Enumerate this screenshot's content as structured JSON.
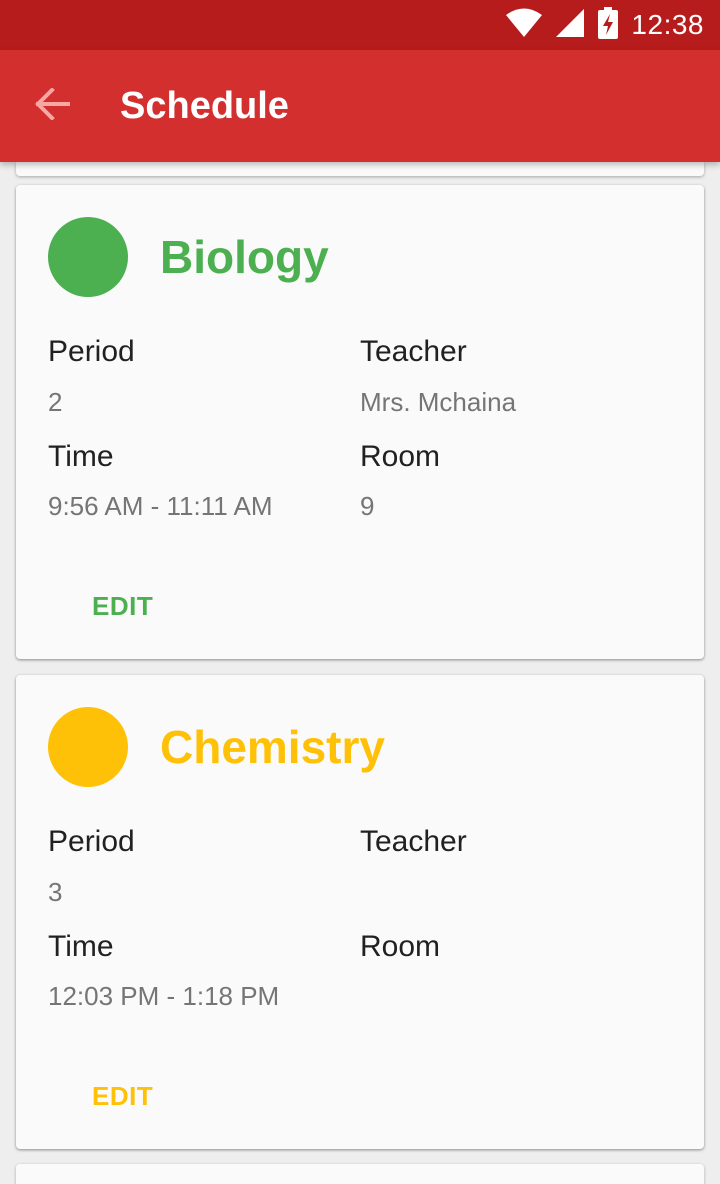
{
  "status_bar": {
    "time": "12:38",
    "icons": [
      "wifi-icon",
      "signal-icon",
      "battery-charging-icon"
    ]
  },
  "app_bar": {
    "title": "Schedule",
    "back_icon": "arrow-back-icon"
  },
  "colors": {
    "status_bar": "#b71c1c",
    "app_bar": "#d32f2f",
    "back_arrow": "#f8a7a2"
  },
  "courses": [
    {
      "name": "Biology",
      "color": "#4caf50",
      "period_label": "Period",
      "period": "2",
      "teacher_label": "Teacher",
      "teacher": "Mrs. Mchaina",
      "time_label": "Time",
      "time": "9:56 AM - 11:11 AM",
      "room_label": "Room",
      "room": "9",
      "edit_label": "EDIT"
    },
    {
      "name": "Chemistry",
      "color": "#ffc107",
      "period_label": "Period",
      "period": "3",
      "teacher_label": "Teacher",
      "teacher": "",
      "time_label": "Time",
      "time": "12:03 PM - 1:18 PM",
      "room_label": "Room",
      "room": "",
      "edit_label": "EDIT"
    }
  ]
}
